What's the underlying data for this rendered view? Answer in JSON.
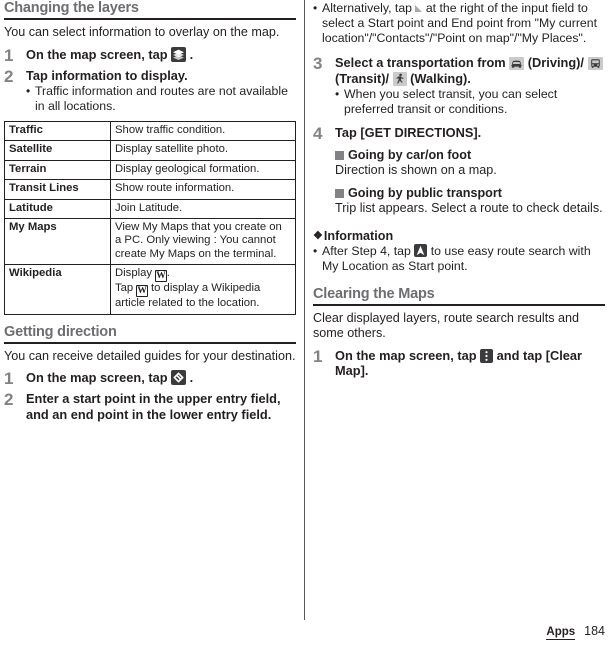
{
  "sections": {
    "changing_layers": {
      "heading": "Changing the layers",
      "intro": "You can select information to overlay on the map.",
      "step1_num": "1",
      "step1_pre": "On the map screen, tap",
      "step1_post": ".",
      "step2_num": "2",
      "step2_title": "Tap information to display.",
      "step2_bullet": "Traffic information and routes are not available in all locations."
    },
    "layers_table": {
      "rows": [
        {
          "name": "Traffic",
          "desc": "Show traffic condition."
        },
        {
          "name": "Satellite",
          "desc": "Display satellite photo."
        },
        {
          "name": "Terrain",
          "desc": "Display geological formation."
        },
        {
          "name": "Transit Lines",
          "desc": "Show route information."
        },
        {
          "name": "Latitude",
          "desc": "Join Latitude."
        },
        {
          "name": "My Maps",
          "desc": "View My Maps that you create on a PC. Only viewing : You cannot create My Maps on the terminal."
        },
        {
          "name": "Wikipedia",
          "desc_line1_pre": "Display",
          "desc_line1_post": ".",
          "desc_line2_pre": "Tap",
          "desc_line2_post": "to display a Wikipedia article related to the location.",
          "icon_label": "W"
        }
      ]
    },
    "getting_direction": {
      "heading": "Getting direction",
      "intro": "You can receive detailed guides for your destination.",
      "step1_num": "1",
      "step1_pre": "On the map screen, tap",
      "step1_post": ".",
      "step2_num": "2",
      "step2_title": "Enter a start point in the upper entry field, and an end point in the lower entry field.",
      "step2_bullet_pre": "Alternatively, tap",
      "step2_bullet_post": "at the right of the input field to select a Start point and End point from \"My current location\"/\"Contacts\"/\"Point on map\"/\"My Places\".",
      "step3_num": "3",
      "step3_t1": "Select a transportation from",
      "step3_t2": "(Driving)/",
      "step3_t3": "(Transit)/",
      "step3_t4": "(Walking).",
      "step3_bullet": "When you select transit, you can select preferred transit or conditions.",
      "step4_num": "4",
      "step4_title": "Tap [GET DIRECTIONS].",
      "sub1_title": "Going by car/on foot",
      "sub1_text": "Direction is shown on a map.",
      "sub2_title": "Going by public transport",
      "sub2_text": "Trip list appears. Select a route to check details."
    },
    "information": {
      "mark": "❖",
      "heading": "Information",
      "bullet_pre": "After Step 4, tap",
      "bullet_post": "to use easy route search with My Location as Start point."
    },
    "clearing_maps": {
      "heading": "Clearing the Maps",
      "intro": "Clear displayed layers, route search results and some others.",
      "step1_num": "1",
      "step1_pre": "On the map screen, tap",
      "step1_mid": "and tap [Clear Map]."
    }
  },
  "footer": {
    "tag": "Apps",
    "page": "184"
  },
  "colors": {
    "heading_gray": "#6d6e71",
    "rule_dark": "#231f20",
    "icon_dark": "#3b3b3d",
    "icon_gray": "#c9cacc",
    "step_number_gray": "#808285"
  }
}
